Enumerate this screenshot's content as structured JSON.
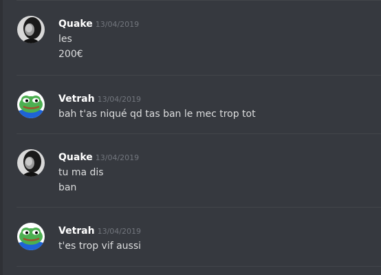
{
  "messages": [
    {
      "username": "Quake",
      "timestamp": "13/04/2019",
      "avatar": "dark-portrait-avatar",
      "lines": [
        "les",
        "200€"
      ]
    },
    {
      "username": "Vetrah",
      "timestamp": "13/04/2019",
      "avatar": "pepe-frog-avatar",
      "lines": [
        "bah t'as niqué qd tas ban le mec trop tot"
      ]
    },
    {
      "username": "Quake",
      "timestamp": "13/04/2019",
      "avatar": "dark-portrait-avatar",
      "lines": [
        "tu ma dis",
        "ban"
      ]
    },
    {
      "username": "Vetrah",
      "timestamp": "13/04/2019",
      "avatar": "pepe-frog-avatar",
      "lines": [
        "t'es trop vif aussi"
      ]
    }
  ],
  "colors": {
    "background": "#36393f",
    "username": "#ffffff",
    "timestamp": "#72767d",
    "message_text": "#dcddde",
    "frog_green": "#4caf50",
    "frog_shirt": "#1e63d6"
  }
}
